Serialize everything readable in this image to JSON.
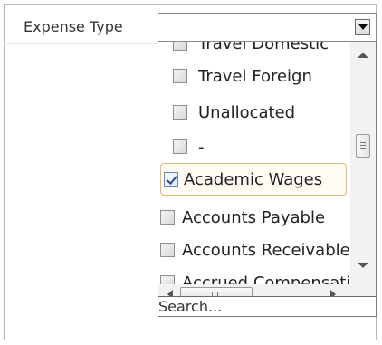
{
  "filter": {
    "label": "Expense Type",
    "selected_value": ""
  },
  "dropdown": {
    "items": [
      {
        "label": "Travel Domestic",
        "checked": false
      },
      {
        "label": "Travel Foreign",
        "checked": false
      },
      {
        "label": "Unallocated",
        "checked": false
      },
      {
        "label": "-",
        "checked": false
      },
      {
        "label": "Academic Wages",
        "checked": true,
        "highlighted": true
      },
      {
        "label": "Accounts Payable",
        "checked": false
      },
      {
        "label": "Accounts Receivable",
        "checked": false
      },
      {
        "label": "Accrued Compensation",
        "checked": false
      }
    ],
    "search_placeholder": "Search..."
  }
}
